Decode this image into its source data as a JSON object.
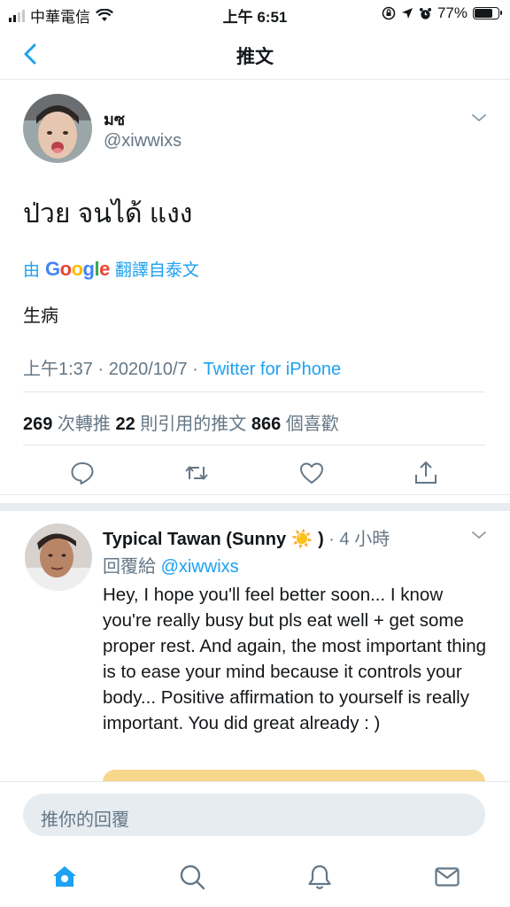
{
  "status_bar": {
    "carrier": "中華電信",
    "time": "上午 6:51",
    "battery": "77%",
    "battery_level": 0.77
  },
  "header": {
    "title": "推文"
  },
  "tweet": {
    "author_name": "มซ",
    "handle": "@xiwwixs",
    "text": "ป่วย จนได้ แงง",
    "translate_prefix": "由",
    "translate_brand": "Google",
    "translate_suffix": "翻譯自泰文",
    "translated_text": "生病",
    "timestamp": "上午1:37 · 2020/10/7 · ",
    "source": "Twitter for iPhone",
    "retweets_count": "269",
    "retweets_label": " 次轉推  ",
    "quotes_count": "22",
    "quotes_label": " 則引用的推文  ",
    "likes_count": "866",
    "likes_label": " 個喜歡"
  },
  "reply": {
    "author_name": "Typical Tawan (Sunny ☀️ )",
    "time": " · 4 小時",
    "replying_to_label": "回覆給 ",
    "replying_to_handle": "@xiwwixs",
    "text": "Hey, I hope you'll feel better soon... I know you're really busy but pls eat well + get some proper rest. And again, the most important thing is to ease your mind because it controls your body... Positive affirmation to yourself is really important. You did great already : )"
  },
  "compose": {
    "placeholder": "推你的回覆"
  },
  "icons": {
    "back": "chevron-left-icon",
    "reply": "comment-icon",
    "retweet": "retweet-icon",
    "like": "heart-icon",
    "share": "share-icon",
    "home": "home-icon",
    "search": "search-icon",
    "notifications": "bell-icon",
    "messages": "mail-icon"
  },
  "colors": {
    "accent": "#1da1f2",
    "secondary_text": "#657786",
    "divider": "#e1e8ed",
    "background_gray": "#e6ecf0"
  }
}
